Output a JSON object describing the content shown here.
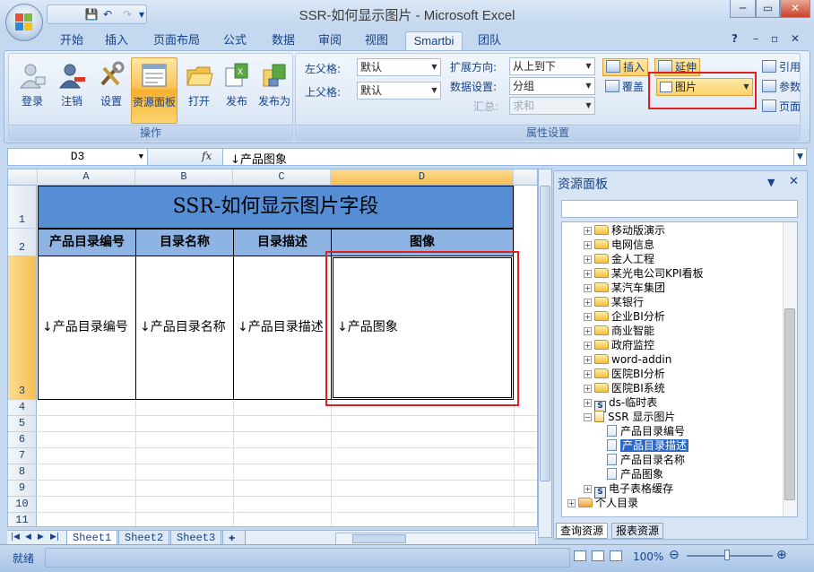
{
  "window": {
    "title": "SSR-如何显示图片 - Microsoft Excel",
    "min_label": "─",
    "max_label": "▭",
    "close_label": "✕"
  },
  "qat": {
    "save": "💾",
    "undo": "↶",
    "redo": "↷",
    "more": "▾"
  },
  "ribbon_tabs": [
    "开始",
    "插入",
    "页面布局",
    "公式",
    "数据",
    "审阅",
    "视图",
    "Smartbi",
    "团队"
  ],
  "active_tab": "Smartbi",
  "help_buttons": {
    "help": "?",
    "min": "–",
    "restore": "▫",
    "close": "✕"
  },
  "operation_group": {
    "label": "操作",
    "buttons": [
      "登录",
      "注销",
      "设置",
      "资源面板",
      "打开",
      "发布",
      "发布为"
    ],
    "active": "资源面板"
  },
  "property_group": {
    "label": "属性设置",
    "left_parent_label": "左父格:",
    "left_parent_value": "默认",
    "top_parent_label": "上父格:",
    "top_parent_value": "默认",
    "expand_label": "扩展方向:",
    "expand_value": "从上到下",
    "data_setting_label": "数据设置:",
    "data_setting_value": "分组",
    "summary_label": "汇总:",
    "summary_value": "求和",
    "insert_label": "插入",
    "extend_label": "延伸",
    "cover_label": "覆盖",
    "image_label": "图片",
    "ref_label": "引用",
    "param_label": "参数",
    "page_label": "页面"
  },
  "formula_bar": {
    "name_box": "D3",
    "fx": "fx",
    "content": "↓产品图象"
  },
  "sheet": {
    "columns": [
      "A",
      "B",
      "C",
      "D"
    ],
    "rows": [
      "1",
      "2",
      "3",
      "4",
      "5",
      "6",
      "7",
      "8",
      "9",
      "10",
      "11"
    ],
    "title": "SSR-如何显示图片字段",
    "headers": [
      "产品目录编号",
      "目录名称",
      "目录描述",
      "图像"
    ],
    "fields": [
      "↓产品目录编号",
      "↓产品目录名称",
      "↓产品目录描述",
      "↓产品图象"
    ],
    "tabs": [
      "Sheet1",
      "Sheet2",
      "Sheet3"
    ],
    "active_tab": "Sheet1"
  },
  "panel": {
    "title": "资源面板",
    "tree": [
      {
        "label": "移动版演示",
        "type": "folder"
      },
      {
        "label": "电网信息",
        "type": "folder"
      },
      {
        "label": "金人工程",
        "type": "folder"
      },
      {
        "label": "某光电公司KPI看板",
        "type": "folder"
      },
      {
        "label": "某汽车集团",
        "type": "folder"
      },
      {
        "label": "某银行",
        "type": "folder"
      },
      {
        "label": "企业BI分析",
        "type": "folder"
      },
      {
        "label": "商业智能",
        "type": "folder"
      },
      {
        "label": "政府监控",
        "type": "folder"
      },
      {
        "label": "word-addin",
        "type": "folder"
      },
      {
        "label": "医院BI分析",
        "type": "folder"
      },
      {
        "label": "医院BI系统",
        "type": "folder"
      },
      {
        "label": "ds-临时表",
        "type": "source"
      },
      {
        "label": "SSR 显示图片",
        "type": "report"
      },
      {
        "label": "产品目录编号",
        "type": "field"
      },
      {
        "label": "产品目录描述",
        "type": "field",
        "selected": true
      },
      {
        "label": "产品目录名称",
        "type": "field"
      },
      {
        "label": "产品图象",
        "type": "field"
      },
      {
        "label": "电子表格缓存",
        "type": "source"
      },
      {
        "label": "个人目录",
        "type": "person"
      }
    ],
    "bottom_tabs": [
      "查询资源",
      "报表资源"
    ]
  },
  "status": {
    "ready": "就绪",
    "zoom": "100%"
  },
  "colors": {
    "title_fill": "#558ed5",
    "header_fill": "#8db4e2",
    "highlight_red": "#e02020",
    "selected_blue": "#3069c5"
  }
}
